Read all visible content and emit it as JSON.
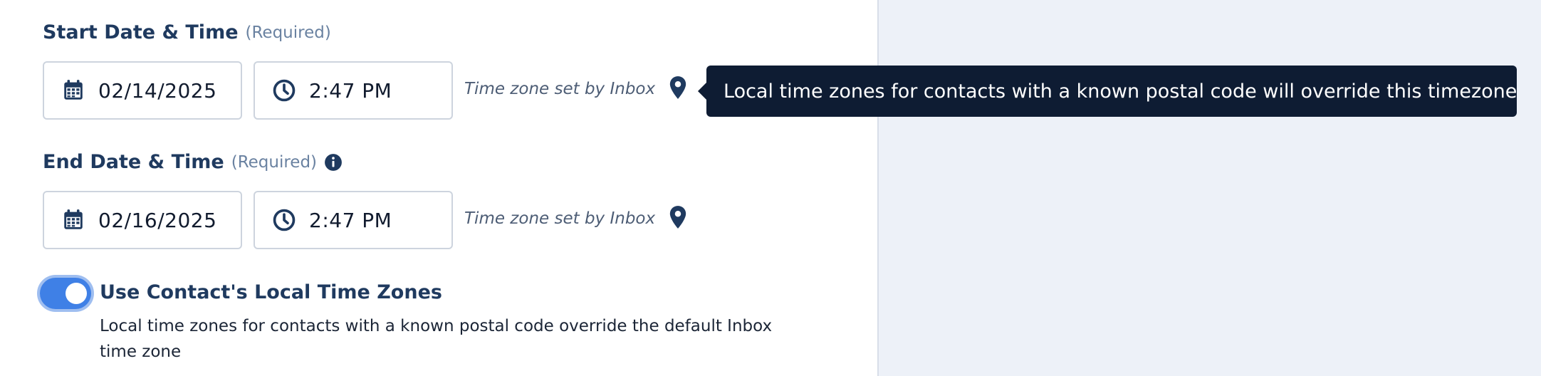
{
  "start": {
    "label": "Start Date & Time",
    "required": "(Required)",
    "date": "02/14/2025",
    "time": "2:47 PM",
    "timezone_note": "Time zone set by Inbox"
  },
  "end": {
    "label": "End Date & Time",
    "required": "(Required)",
    "date": "02/16/2025",
    "time": "2:47 PM",
    "timezone_note": "Time zone set by Inbox"
  },
  "tooltip": {
    "text": "Local time zones for contacts with a known postal code will override this timezone"
  },
  "local_tz": {
    "enabled": true,
    "title": "Use Contact's Local Time Zones",
    "description": "Local time zones for contacts with a known postal code override the default Inbox time zone"
  },
  "colors": {
    "label": "#1f3a5f",
    "tooltip_bg": "#0e1c33",
    "toggle_on": "#3f80e6",
    "right_panel_bg": "#edf1f8"
  },
  "icons": {
    "date": "calendar-icon",
    "time": "clock-icon",
    "timezone": "map-pin-icon",
    "info": "info-icon"
  }
}
